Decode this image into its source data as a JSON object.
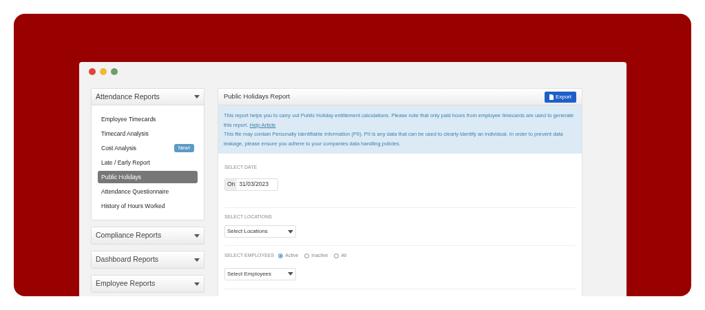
{
  "sidebar": {
    "sections": [
      {
        "title": "Attendance Reports",
        "expanded": true,
        "items": [
          {
            "label": "Employee Timecards",
            "selected": false
          },
          {
            "label": "Timecard Analysis",
            "selected": false
          },
          {
            "label": "Cost Analysis",
            "selected": false,
            "badge": "New!"
          },
          {
            "label": "Late / Early Report",
            "selected": false
          },
          {
            "label": "Public Holidays",
            "selected": true
          },
          {
            "label": "Attendance Questionnaire",
            "selected": false
          },
          {
            "label": "History of Hours Worked",
            "selected": false
          }
        ]
      },
      {
        "title": "Compliance Reports",
        "expanded": false
      },
      {
        "title": "Dashboard Reports",
        "expanded": false
      },
      {
        "title": "Employee Reports",
        "expanded": false
      }
    ]
  },
  "report": {
    "title": "Public Holidays Report",
    "export_button": "Export",
    "info": [
      "This report helps you to carry out Public Holiday entitlement calculations. Please note that only paid hours from employee timecards are used to generate this report.",
      "This file may contain Personally Identifiable Information (PII). PII is any data that can be used to clearly identify an individual. In order to prevent data leakage, please ensure you adhere to your companies data handling policies."
    ],
    "help_link": "Help Article",
    "date": {
      "label": "SELECT DATE",
      "prefix": "On",
      "value": "31/03/2023"
    },
    "locations": {
      "label": "SELECT LOCATIONS",
      "placeholder": "Select Locations"
    },
    "employees": {
      "label": "SELECT EMPLOYEES",
      "options": [
        {
          "label": "Active",
          "selected": true
        },
        {
          "label": "Inactive",
          "selected": false
        },
        {
          "label": "All",
          "selected": false
        }
      ],
      "placeholder": "Select Employees"
    }
  }
}
